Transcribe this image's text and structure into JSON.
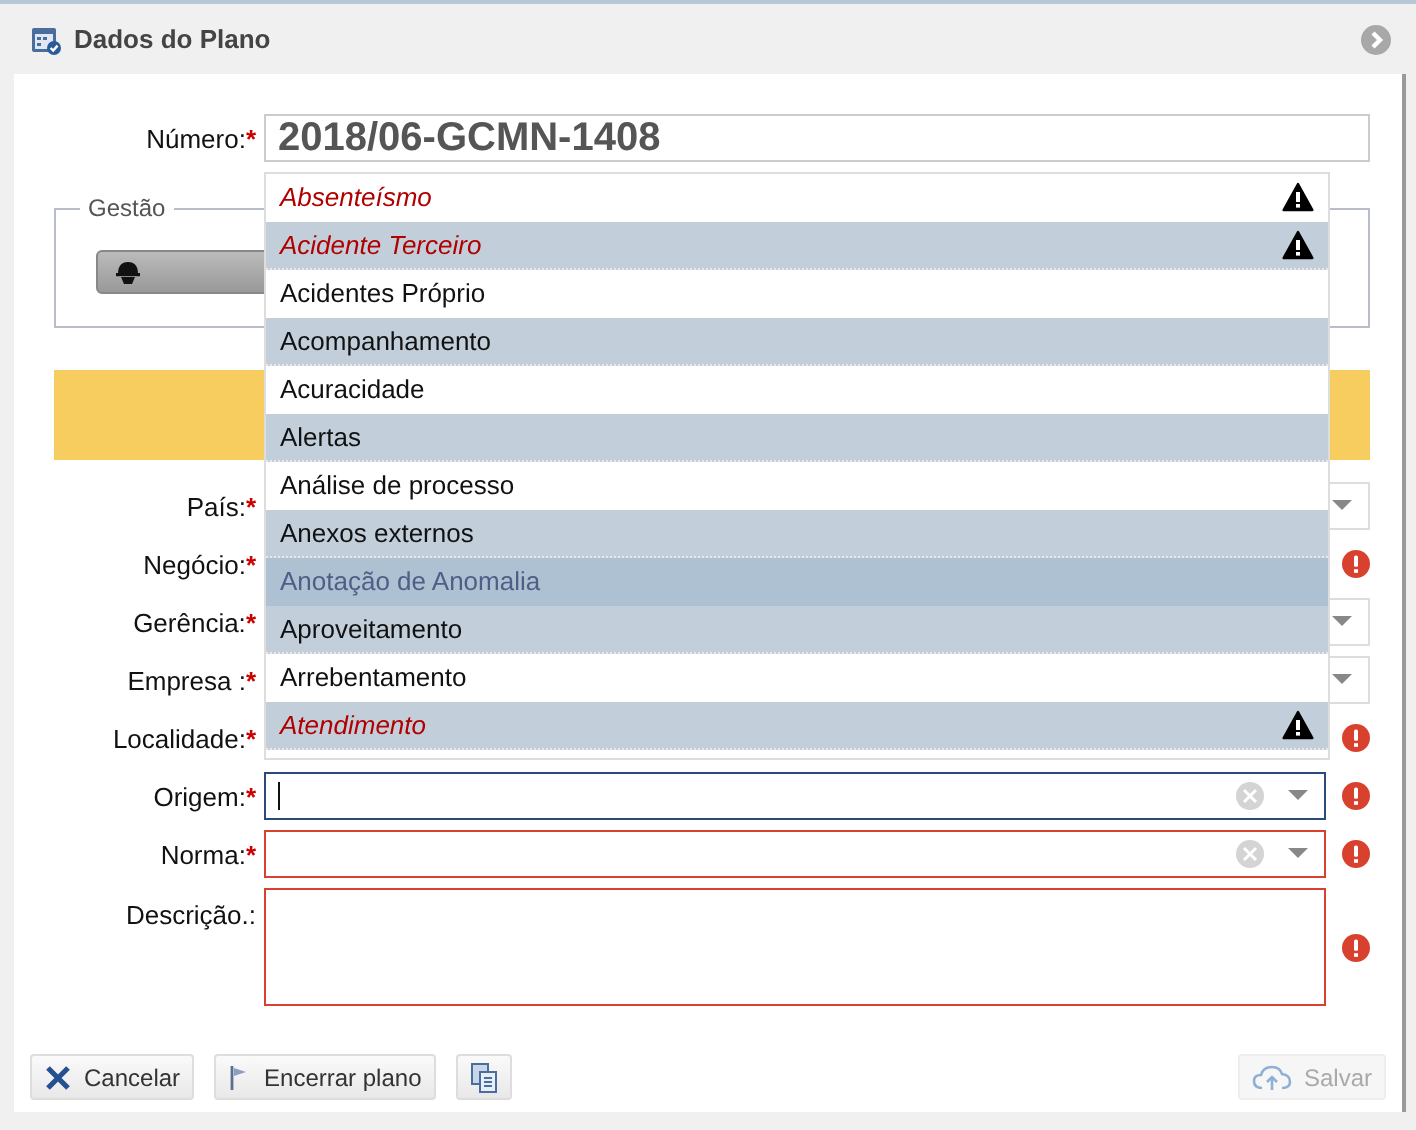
{
  "panel": {
    "title": "Dados do Plano"
  },
  "numero": {
    "label": "Número:",
    "required_mark": "*",
    "value": "2018/06-GCMN-1408"
  },
  "gestao": {
    "legend": "Gestão"
  },
  "fields": [
    {
      "label": "País:",
      "required_mark": "*",
      "kind": "select",
      "error": false,
      "focused": false
    },
    {
      "label": "Negócio:",
      "required_mark": "*",
      "kind": "covered",
      "error": true
    },
    {
      "label": "Gerência:",
      "required_mark": "*",
      "kind": "select",
      "error": false,
      "focused": false
    },
    {
      "label": "Empresa :",
      "required_mark": "*",
      "kind": "select",
      "error": false,
      "focused": false
    },
    {
      "label": "Localidade:",
      "required_mark": "*",
      "kind": "covered",
      "error": true
    },
    {
      "label": "Origem:",
      "required_mark": "*",
      "kind": "combo",
      "error": true,
      "focused": true
    },
    {
      "label": "Norma:",
      "required_mark": "*",
      "kind": "combo",
      "error": true,
      "focused": false
    },
    {
      "label": "Descrição.:",
      "kind": "textarea",
      "error": true,
      "focused": false
    }
  ],
  "dropdown": {
    "items": [
      {
        "label": "Absenteísmo",
        "warning": true,
        "selected": false
      },
      {
        "label": "Acidente Terceiro",
        "warning": true,
        "selected": false
      },
      {
        "label": "Acidentes Próprio",
        "warning": false,
        "selected": false
      },
      {
        "label": "Acompanhamento",
        "warning": false,
        "selected": false
      },
      {
        "label": "Acuracidade",
        "warning": false,
        "selected": false
      },
      {
        "label": "Alertas",
        "warning": false,
        "selected": false
      },
      {
        "label": "Análise de processo",
        "warning": false,
        "selected": false
      },
      {
        "label": "Anexos externos",
        "warning": false,
        "selected": false
      },
      {
        "label": "Anotação de Anomalia",
        "warning": false,
        "selected": true
      },
      {
        "label": "Aproveitamento",
        "warning": false,
        "selected": false
      },
      {
        "label": "Arrebentamento",
        "warning": false,
        "selected": false
      },
      {
        "label": "Atendimento",
        "warning": true,
        "selected": false
      }
    ]
  },
  "buttons": [
    {
      "label": "Cancelar",
      "kind": "cancel",
      "disabled": false
    },
    {
      "label": "Encerrar plano",
      "kind": "close-plan",
      "disabled": false
    },
    {
      "kind": "copy",
      "disabled": false
    },
    {
      "label": "Salvar",
      "kind": "save",
      "disabled": true
    }
  ]
}
